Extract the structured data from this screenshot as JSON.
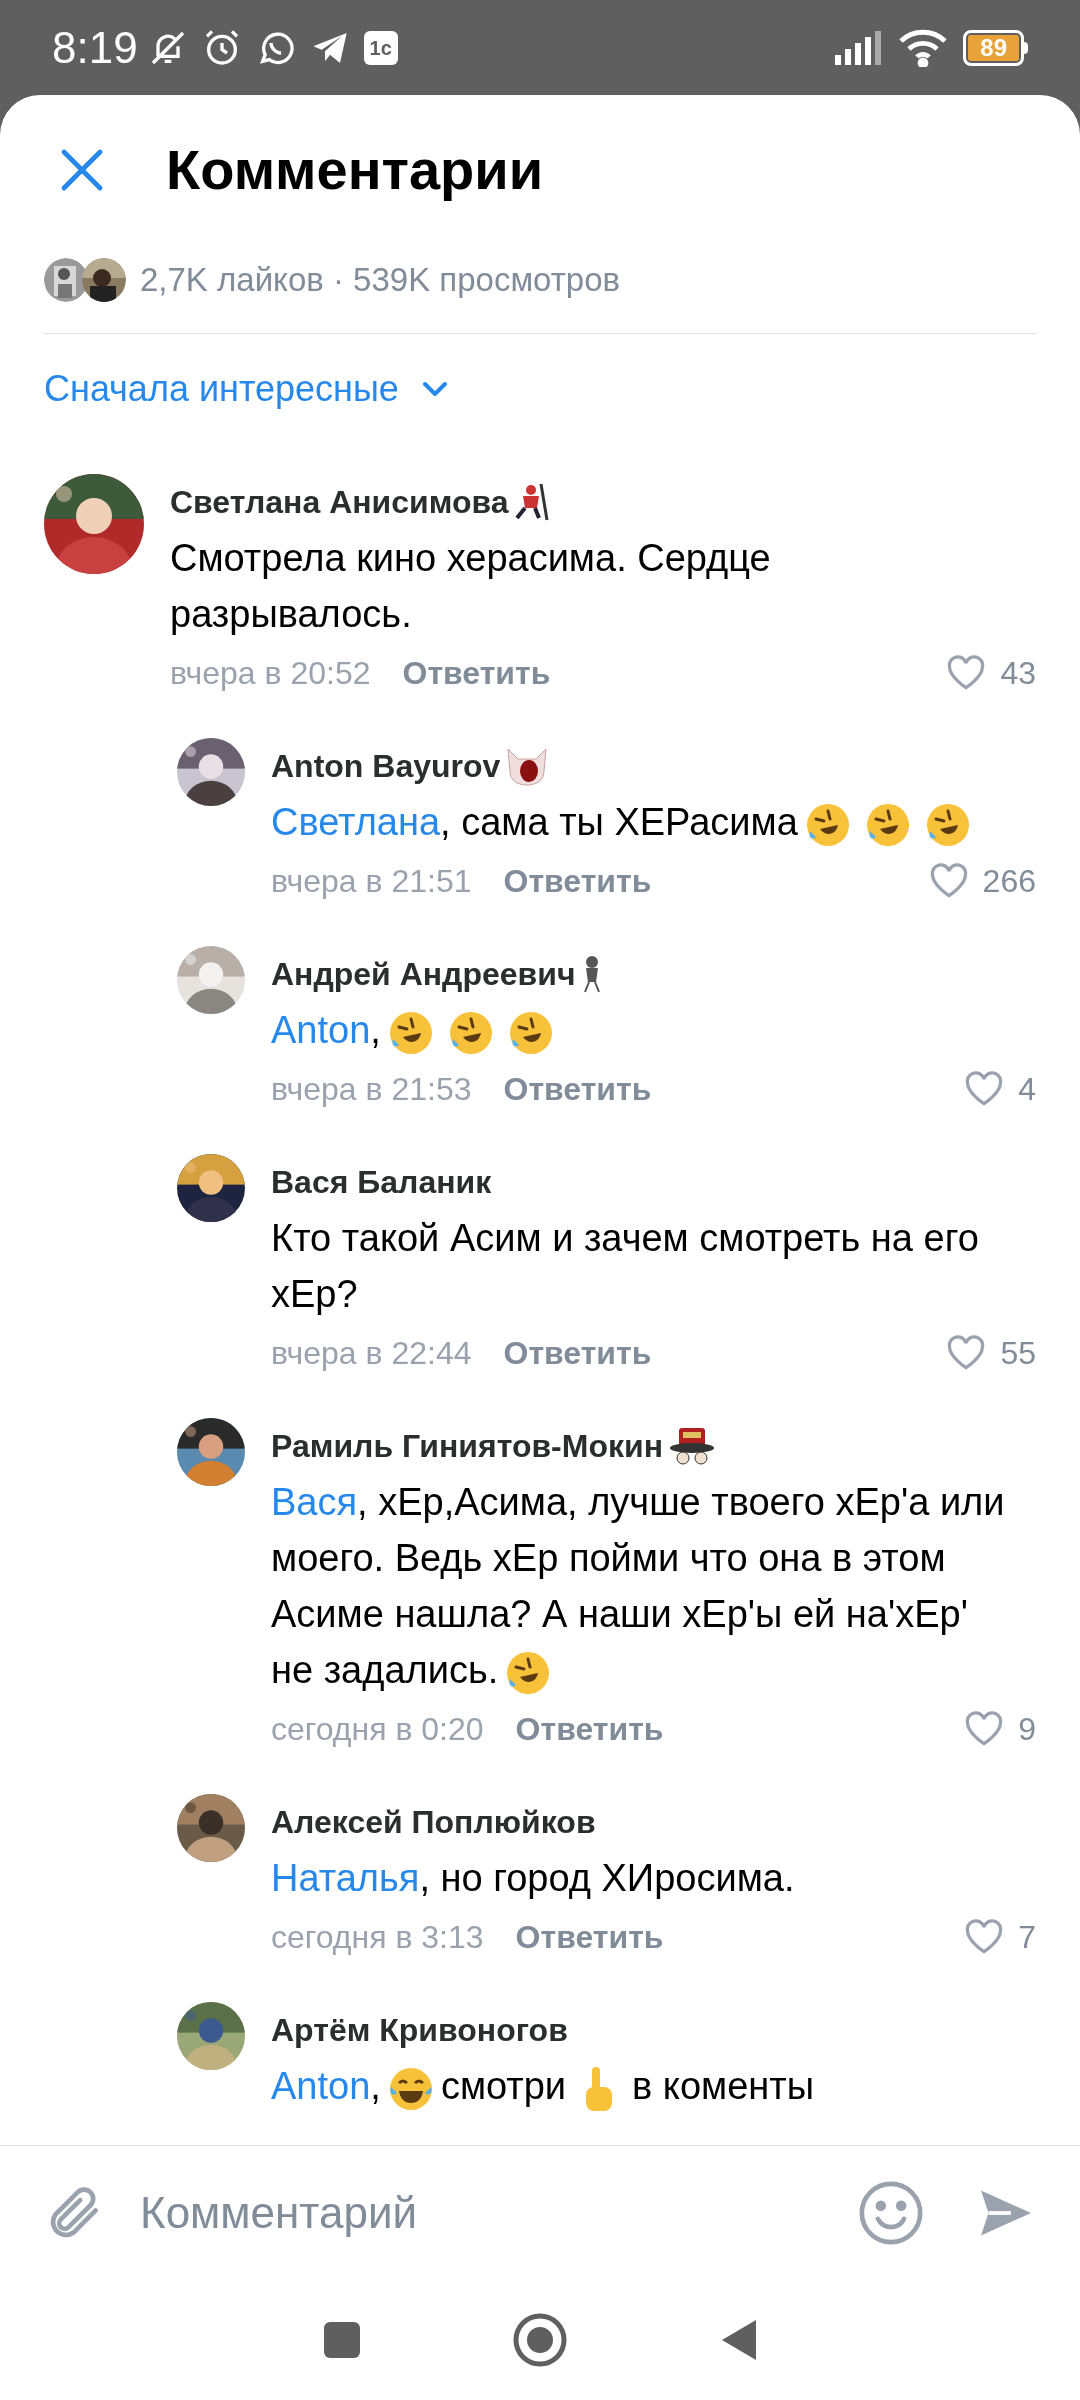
{
  "status_bar": {
    "time": "8:19",
    "app_badge": "1с",
    "battery": "89"
  },
  "header": {
    "title": "Комментарии"
  },
  "stats": {
    "text": "2,7K лайков · 539K просмотров"
  },
  "sort": {
    "label": "Сначала интересные"
  },
  "comments": [
    {
      "author": "Светлана Анисимова",
      "kind": "hockey",
      "reply": false,
      "body": [
        {
          "kind": "text",
          "text": "Смотрела кино херасима. Сердце разрывалось."
        }
      ],
      "time": "вчера в 20:52",
      "reply_label": "Ответить",
      "likes": "43"
    },
    {
      "author": "Anton Bayurov",
      "kind": "cat",
      "reply": true,
      "body": [
        {
          "kind": "mention",
          "text": "Светлана"
        },
        {
          "kind": "text",
          "text": ", сама ты ХЕРасима"
        },
        {
          "kind": "rofl"
        },
        {
          "kind": "rofl"
        },
        {
          "kind": "rofl"
        }
      ],
      "time": "вчера в 21:51",
      "reply_label": "Ответить",
      "likes": "266"
    },
    {
      "author": "Андрей Андреевич",
      "kind": "mouse",
      "reply": true,
      "body": [
        {
          "kind": "mention",
          "text": "Anton"
        },
        {
          "kind": "text",
          "text": ","
        },
        {
          "kind": "rofl"
        },
        {
          "kind": "rofl"
        },
        {
          "kind": "rofl"
        }
      ],
      "time": "вчера в 21:53",
      "reply_label": "Ответить",
      "likes": "4"
    },
    {
      "author": "Вася Баланик",
      "kind": "plain",
      "reply": true,
      "body": [
        {
          "kind": "text",
          "text": "Кто такой Асим и зачем смотреть на его хЕр?"
        }
      ],
      "time": "вчера в 22:44",
      "reply_label": "Ответить",
      "likes": "55"
    },
    {
      "author": "Рамиль Гиниятов-Мокин",
      "kind": "hat",
      "reply": true,
      "body": [
        {
          "kind": "mention",
          "text": "Вася"
        },
        {
          "kind": "text",
          "text": ", хЕр,Асима, лучше твоего хЕр'а или моего. Ведь хЕр пойми что она в этом Асиме нашла? А наши хЕр'ы ей на'хЕр' не задались."
        },
        {
          "kind": "rofl"
        }
      ],
      "time": "сегодня в 0:20",
      "reply_label": "Ответить",
      "likes": "9"
    },
    {
      "author": "Алексей Поплюйков",
      "kind": "plain",
      "reply": true,
      "body": [
        {
          "kind": "mention",
          "text": "Наталья"
        },
        {
          "kind": "text",
          "text": ", но город ХИросима."
        }
      ],
      "time": "сегодня в 3:13",
      "reply_label": "Ответить",
      "likes": "7"
    },
    {
      "author": "Артём Кривоногов",
      "kind": "plain",
      "reply": true,
      "body": [
        {
          "kind": "mention",
          "text": "Anton"
        },
        {
          "kind": "text",
          "text": ","
        },
        {
          "kind": "joy"
        },
        {
          "kind": "text",
          "text": "смотри"
        },
        {
          "kind": "point_up"
        },
        {
          "kind": "text",
          "text": "в коменты"
        }
      ]
    }
  ],
  "composer": {
    "placeholder": "Комментарий"
  }
}
